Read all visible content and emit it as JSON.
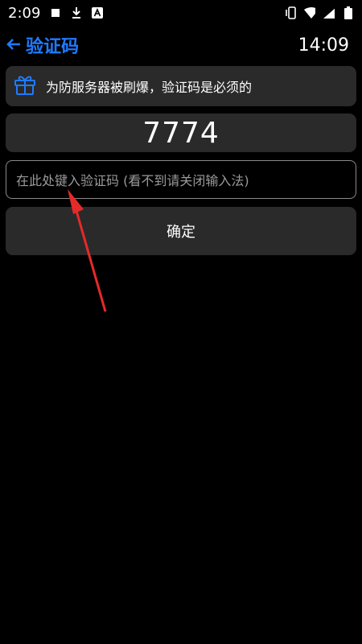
{
  "status_bar": {
    "time": "2:09",
    "icons": [
      "stop-square-icon",
      "download-icon",
      "app-a-icon",
      "vibrate-icon",
      "wifi-icon",
      "signal-icon",
      "battery-icon"
    ]
  },
  "app_bar": {
    "back_icon": "back-arrow-icon",
    "title": "验证码",
    "clock": "14:09"
  },
  "notice": {
    "icon": "gift-icon",
    "text": "为防服务器被刷爆，验证码是必须的"
  },
  "captcha": {
    "code": "7774"
  },
  "input": {
    "placeholder": "在此处键入验证码 (看不到请关闭输入法)"
  },
  "submit": {
    "label": "确定"
  },
  "colors": {
    "accent": "#1e7bff",
    "card": "#2a2a2a",
    "annotation_arrow": "#e52a2a"
  }
}
